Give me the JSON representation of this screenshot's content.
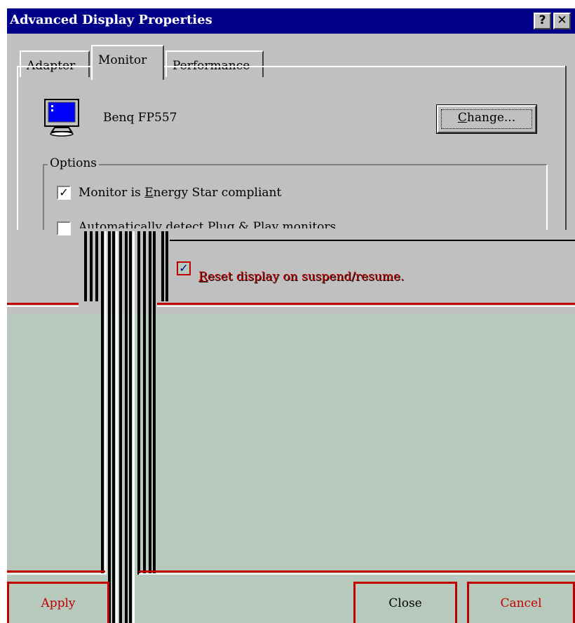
{
  "window": {
    "title": "Advanced Display Properties",
    "help_button": "?",
    "close_button": "✕"
  },
  "tabs": [
    {
      "label": "Adapter"
    },
    {
      "label": "Monitor"
    },
    {
      "label": "Performance"
    }
  ],
  "monitor": {
    "name": "Benq FP557",
    "change_button": {
      "prefix": "",
      "underlined": "C",
      "rest": "hange..."
    }
  },
  "options": {
    "title": "Options",
    "energy_star": {
      "checked": true,
      "prefix": "Monitor is ",
      "underlined": "E",
      "rest": "nergy Star compliant"
    },
    "auto_detect": {
      "checked": false,
      "label": "Automatically detect Plug & Play monitors"
    },
    "reset_display": {
      "checked": true,
      "underlined": "R",
      "rest": "eset display on suspend/resume."
    }
  },
  "buttons": {
    "apply": "Apply",
    "close": "Close",
    "cancel": "Cancel"
  },
  "colors": {
    "titlebar": "#000088",
    "face": "#c0c0c0",
    "glitch_bg": "#b7c9bc",
    "glitch_accent": "#c00000"
  }
}
